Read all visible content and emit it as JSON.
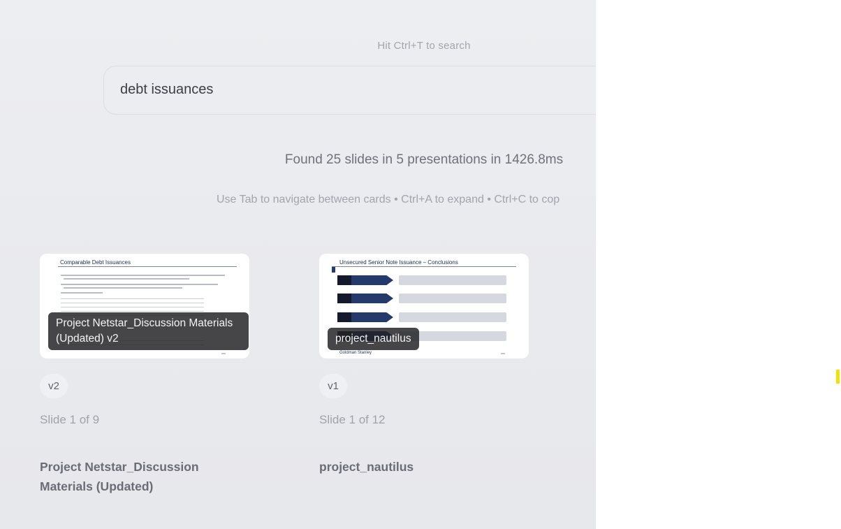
{
  "search": {
    "hint": "Hit Ctrl+T to search",
    "value": "debt issuances"
  },
  "results": {
    "summary": "Found 25 slides in 5 presentations in 1426.8ms",
    "shortcuts": "Use Tab to navigate between cards • Ctrl+A to expand • Ctrl+C to cop"
  },
  "cards": [
    {
      "thumb_title": "Comparable Debt Issuances",
      "overlay": "Project Netstar_Discussion Materials (Updated) v2",
      "version": "v2",
      "slide_position": "Slide 1 of 9",
      "presentation": "Project Netstar_Discussion Materials (Updated)"
    },
    {
      "thumb_title": "Unsecured Senior Note Issuance – Conclusions",
      "thumb_footer": "Goldman Stanley",
      "overlay": "project_nautilus",
      "version": "v1",
      "slide_position": "Slide 1 of 12",
      "presentation": "project_nautilus"
    }
  ],
  "colors": {
    "background": "#e9eaee",
    "slide_navy": "#243a6b",
    "overlay": "#222225"
  }
}
